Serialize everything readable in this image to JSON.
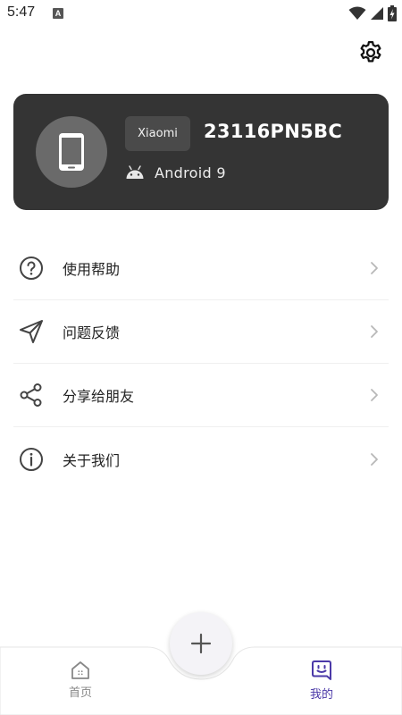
{
  "status_bar": {
    "time": "5:47",
    "notification_badge": "A",
    "icons": [
      "wifi-icon",
      "signal-icon",
      "battery-charging-icon"
    ]
  },
  "header": {
    "settings_icon": "gear-icon"
  },
  "device": {
    "brand": "Xiaomi",
    "model": "23116PN5BC",
    "os_version": "Android 9",
    "avatar_icon": "phone-icon",
    "os_icon": "android-icon"
  },
  "menu": {
    "items": [
      {
        "label": "使用帮助",
        "icon": "help-circle-icon"
      },
      {
        "label": "问题反馈",
        "icon": "send-icon"
      },
      {
        "label": "分享给朋友",
        "icon": "share-icon"
      },
      {
        "label": "关于我们",
        "icon": "info-icon"
      }
    ]
  },
  "bottom_nav": {
    "tabs": [
      {
        "label": "首页",
        "icon": "home-icon",
        "active": false
      },
      {
        "label": "我的",
        "icon": "smiley-chat-icon",
        "active": true
      }
    ],
    "fab_icon": "plus-icon"
  },
  "colors": {
    "card_background": "#343434",
    "active_tab": "#4b39a8",
    "inactive_tab": "#888888"
  }
}
